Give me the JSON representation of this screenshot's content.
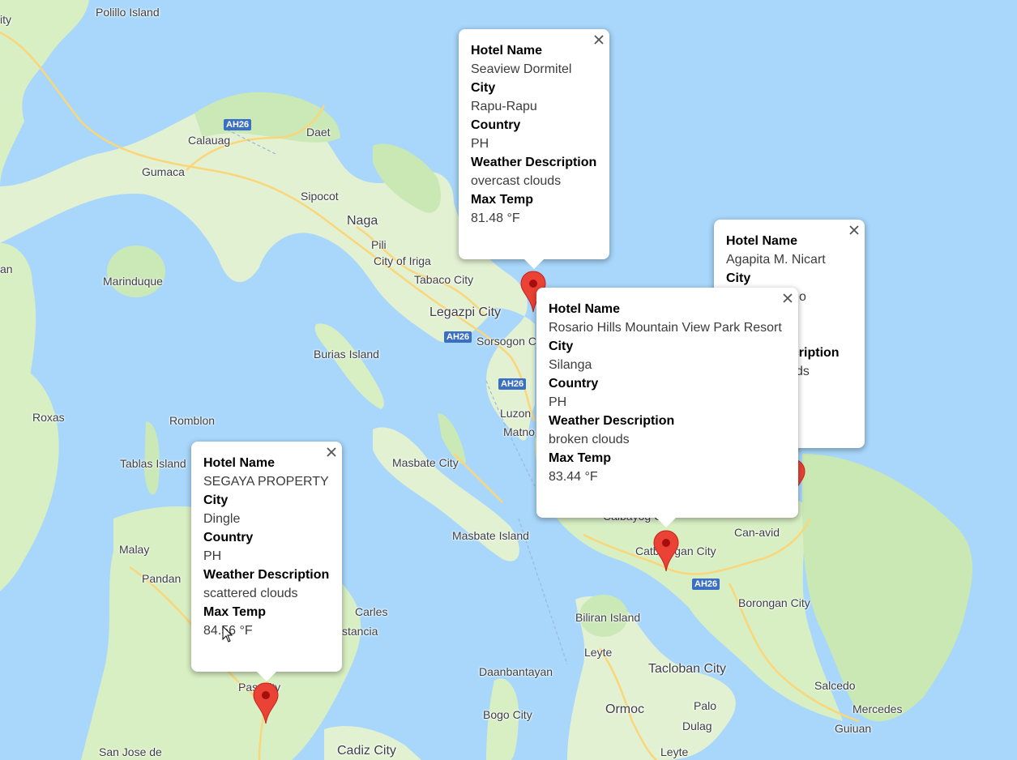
{
  "map": {
    "labels": [
      {
        "id": "polillo-island",
        "text": "Polillo Island"
      },
      {
        "id": "ity",
        "text": "ity"
      },
      {
        "id": "ah26-1",
        "text": "AH26"
      },
      {
        "id": "daet",
        "text": "Daet"
      },
      {
        "id": "calauag",
        "text": "Calauag"
      },
      {
        "id": "gumaca",
        "text": "Gumaca"
      },
      {
        "id": "sipocot",
        "text": "Sipocot"
      },
      {
        "id": "naga",
        "text": "Naga"
      },
      {
        "id": "pili",
        "text": "Pili"
      },
      {
        "id": "city-of-iriga",
        "text": "City of Iriga"
      },
      {
        "id": "an",
        "text": "an"
      },
      {
        "id": "marinduque",
        "text": "Marinduque"
      },
      {
        "id": "tabaco-city",
        "text": "Tabaco City"
      },
      {
        "id": "legazpi-city",
        "text": "Legazpi City"
      },
      {
        "id": "ah26-2",
        "text": "AH26"
      },
      {
        "id": "sorsogon",
        "text": "Sorsogon C"
      },
      {
        "id": "burias-island",
        "text": "Burias Island"
      },
      {
        "id": "ah26-3",
        "text": "AH26"
      },
      {
        "id": "luzon",
        "text": "Luzon"
      },
      {
        "id": "matnog",
        "text": "Matno"
      },
      {
        "id": "roxas",
        "text": "Roxas"
      },
      {
        "id": "romblon",
        "text": "Romblon"
      },
      {
        "id": "tablas-island",
        "text": "Tablas Island"
      },
      {
        "id": "masbate-city",
        "text": "Masbate City"
      },
      {
        "id": "masbate-island",
        "text": "Masbate Island"
      },
      {
        "id": "malay",
        "text": "Malay"
      },
      {
        "id": "pandan",
        "text": "Pandan"
      },
      {
        "id": "carles",
        "text": "Carles"
      },
      {
        "id": "estancia",
        "text": "stancia"
      },
      {
        "id": "calbayog",
        "text": "Calbayog City"
      },
      {
        "id": "can-avid",
        "text": "Can-avid"
      },
      {
        "id": "catbalogan",
        "text": "Catbalogan City"
      },
      {
        "id": "ah26-4",
        "text": "AH26"
      },
      {
        "id": "borongan",
        "text": "Borongan City"
      },
      {
        "id": "biliran-island",
        "text": "Biliran Island"
      },
      {
        "id": "leyte",
        "text": "Leyte"
      },
      {
        "id": "daanbantayan",
        "text": "Daanbantayan"
      },
      {
        "id": "tacloban",
        "text": "Tacloban City"
      },
      {
        "id": "palo",
        "text": "Palo"
      },
      {
        "id": "salcedo",
        "text": "Salcedo"
      },
      {
        "id": "ormoc",
        "text": "Ormoc"
      },
      {
        "id": "dulag",
        "text": "Dulag"
      },
      {
        "id": "mercedes",
        "text": "Mercedes"
      },
      {
        "id": "guiuan",
        "text": "Guiuan"
      },
      {
        "id": "bogo-city",
        "text": "Bogo City"
      },
      {
        "id": "passi",
        "text": "Pas City"
      },
      {
        "id": "san-jose",
        "text": "San Jose de"
      },
      {
        "id": "cadiz-city",
        "text": "Cadiz City"
      },
      {
        "id": "leyte-2",
        "text": "Leyte"
      }
    ],
    "colors": {
      "water": "#a8d7fb",
      "land": "#e5f2d4",
      "land_green": "#c4e6b1",
      "road": "#f9d67a",
      "marker": "#ea4335"
    }
  },
  "popups": [
    {
      "id": "popup-rapu-rapu",
      "fields": [
        {
          "label": "Hotel Name",
          "value": "Seaview Dormitel"
        },
        {
          "label": "City",
          "value": "Rapu-Rapu"
        },
        {
          "label": "Country",
          "value": "PH"
        },
        {
          "label": "Weather Description",
          "value": "overcast clouds"
        },
        {
          "label": "Max Temp",
          "value": "81.48 °F"
        }
      ]
    },
    {
      "id": "popup-partial",
      "fields": [
        {
          "label": "Hotel Name",
          "value": "Agapita M. Nicart"
        },
        {
          "label": "City",
          "value": "o"
        },
        {
          "label": "",
          "value": ""
        },
        {
          "label": "scription",
          "value": "ds"
        },
        {
          "label": "",
          "value": ""
        }
      ]
    },
    {
      "id": "popup-silanga",
      "fields": [
        {
          "label": "Hotel Name",
          "value": "Rosario Hills Mountain View Park Resort"
        },
        {
          "label": "City",
          "value": "Silanga"
        },
        {
          "label": "Country",
          "value": "PH"
        },
        {
          "label": "Weather Description",
          "value": "broken clouds"
        },
        {
          "label": "Max Temp",
          "value": "83.44 °F"
        }
      ]
    },
    {
      "id": "popup-dingle",
      "fields": [
        {
          "label": "Hotel Name",
          "value": "SEGAYA PROPERTY"
        },
        {
          "label": "City",
          "value": "Dingle"
        },
        {
          "label": "Country",
          "value": "PH"
        },
        {
          "label": "Weather Description",
          "value": "scattered clouds"
        },
        {
          "label": "Max Temp",
          "value": "84.56 °F"
        }
      ]
    }
  ]
}
